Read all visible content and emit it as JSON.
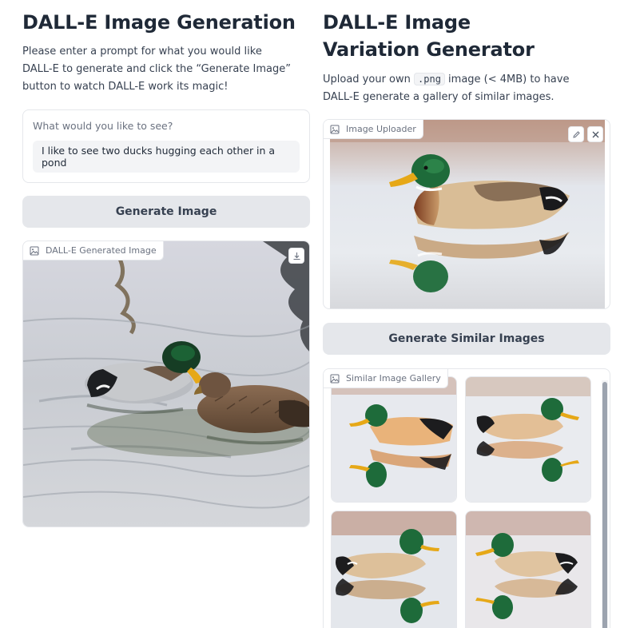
{
  "left": {
    "title": "DALL-E Image Generation",
    "description": "Please enter a prompt for what you would like DALL-E to generate and click the “Generate Image” button to watch DALL-E work its magic!",
    "prompt_label": "What would you like to see?",
    "prompt_value": "I like to see two ducks hugging each other in a pond",
    "generate_button": "Generate Image",
    "output_label": "DALL-E Generated Image",
    "download_icon": "download-icon"
  },
  "right": {
    "title": "DALL-E Image Variation Generator",
    "description_before": "Upload your own ",
    "description_code": ".png",
    "description_after": " image (< 4MB) to have DALL-E generate a gallery of similar images.",
    "uploader_label": "Image Uploader",
    "edit_icon": "pencil-icon",
    "clear_icon": "close-icon",
    "similar_button": "Generate Similar Images",
    "gallery_label": "Similar Image Gallery"
  },
  "colors": {
    "button_bg": "#e5e7eb",
    "border": "#e5e7eb",
    "text": "#1f2937",
    "mallard_green": "#1e6b3a",
    "beak_yellow": "#e6a817"
  }
}
